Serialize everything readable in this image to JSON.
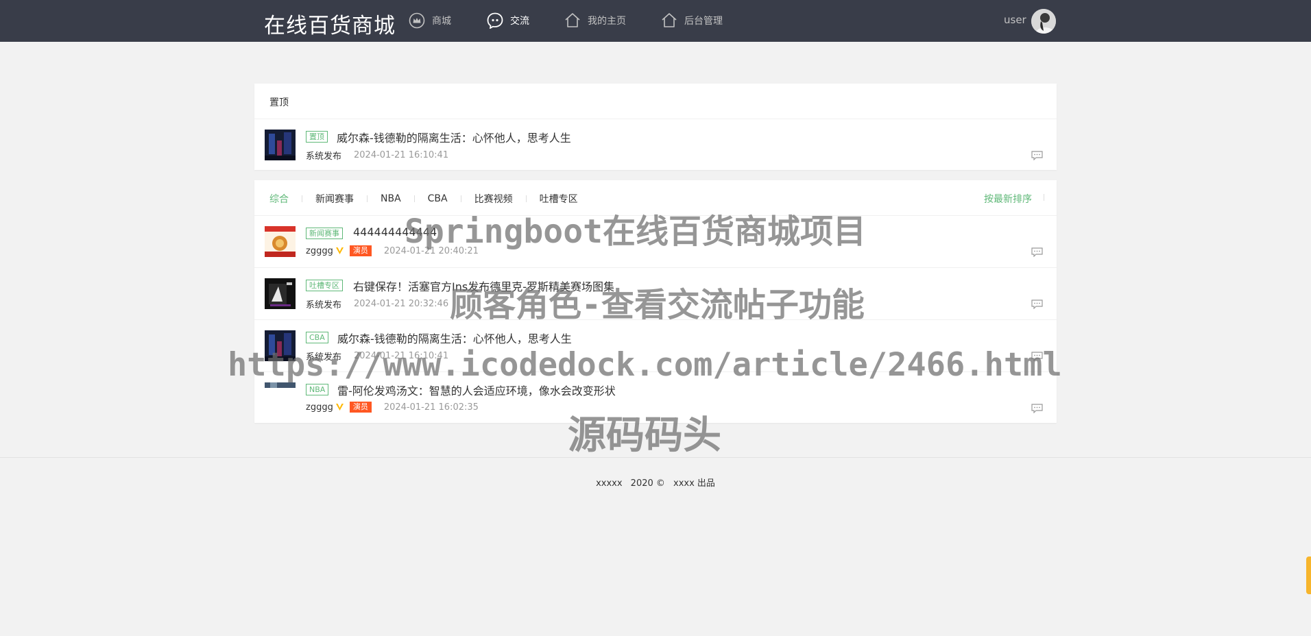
{
  "header": {
    "logo": "在线百货商城",
    "nav": [
      {
        "label": "商城",
        "icon": "crown-icon"
      },
      {
        "label": "交流",
        "icon": "chat-icon"
      },
      {
        "label": "我的主页",
        "icon": "home-icon"
      },
      {
        "label": "后台管理",
        "icon": "home-icon"
      }
    ],
    "user_name": "user"
  },
  "pinned": {
    "title": "置顶",
    "posts": [
      {
        "tag": "置顶",
        "title": "威尔森-钱德勒的隔离生活：心怀他人，思考人生",
        "author": "系统发布",
        "time": "2024-01-21 16:10:41"
      }
    ]
  },
  "feed": {
    "tabs": [
      "综合",
      "新闻赛事",
      "NBA",
      "CBA",
      "比赛视频",
      "吐槽专区"
    ],
    "sort_label": "按最新排序",
    "posts": [
      {
        "tag": "新闻赛事",
        "title": "444444444444",
        "author": "zgggg",
        "badge": "演员",
        "time": "2024-01-21 20:40:21"
      },
      {
        "tag": "吐槽专区",
        "title": "右键保存！活塞官方Ins发布德里克-罗斯精美赛场图集",
        "author": "系统发布",
        "time": "2024-01-21 20:32:46"
      },
      {
        "tag": "CBA",
        "title": "威尔森-钱德勒的隔离生活：心怀他人，思考人生",
        "author": "系统发布",
        "time": "2024-01-21 16:10:41"
      },
      {
        "tag": "NBA",
        "title": "雷-阿伦发鸡汤文：智慧的人会适应环境，像水会改变形状",
        "author": "zgggg",
        "badge": "演员",
        "time": "2024-01-21 16:02:35"
      }
    ]
  },
  "footer": {
    "site": "xxxxx",
    "year": "2020 ©",
    "credit": "xxxx 出品"
  },
  "watermark": {
    "line1": "Springboot在线百货商城项目",
    "line2": "顾客角色-查看交流帖子功能",
    "line3": "https://www.icodedock.com/article/2466.html",
    "line4": "源码码头"
  },
  "colors": {
    "header_bg": "#393d49",
    "accent": "#5fb878",
    "badge": "#ff5722"
  }
}
